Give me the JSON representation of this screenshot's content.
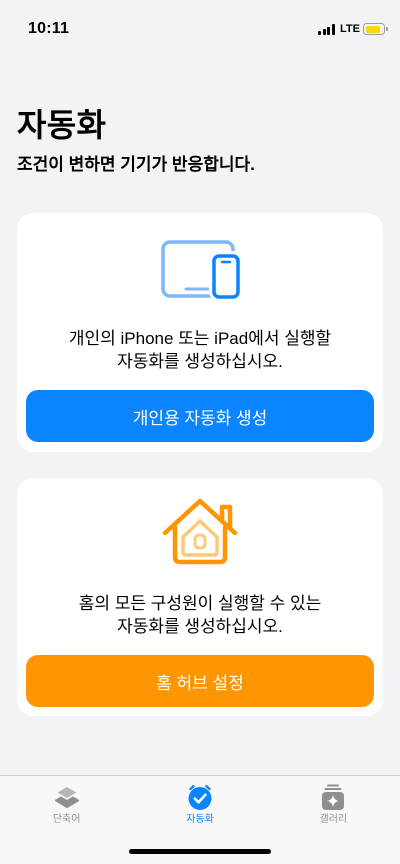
{
  "status_bar": {
    "time": "10:11",
    "network": "LTE",
    "signal_bars": 4,
    "battery_level": 0.85
  },
  "colors": {
    "background": "#F2F2F7",
    "accent_blue": "#0A84FF",
    "accent_orange": "#FF9500",
    "battery_fill": "#FFD60A",
    "tab_inactive": "#8E8E93"
  },
  "header": {
    "title": "자동화",
    "subtitle": "조건이 변하면 기기가 반응합니다."
  },
  "cards": [
    {
      "icon": "ipad-iphone-icon",
      "description": [
        "개인의 iPhone 또는 iPad에서 실행할",
        "자동화를 생성하십시오."
      ],
      "button_label": "개인용 자동화 생성",
      "button_color": "#0A84FF"
    },
    {
      "icon": "home-icon",
      "description": [
        "홈의 모든 구성원이 실행할 수 있는",
        "자동화를 생성하십시오."
      ],
      "button_label": "홈 허브 설정",
      "button_color": "#FF9500"
    }
  ],
  "tab_bar": {
    "tabs": [
      {
        "label": "단축어",
        "icon": "layers-icon",
        "selected": false
      },
      {
        "label": "자동화",
        "icon": "automation-icon",
        "selected": true
      },
      {
        "label": "갤러리",
        "icon": "gallery-icon",
        "selected": false
      }
    ]
  }
}
